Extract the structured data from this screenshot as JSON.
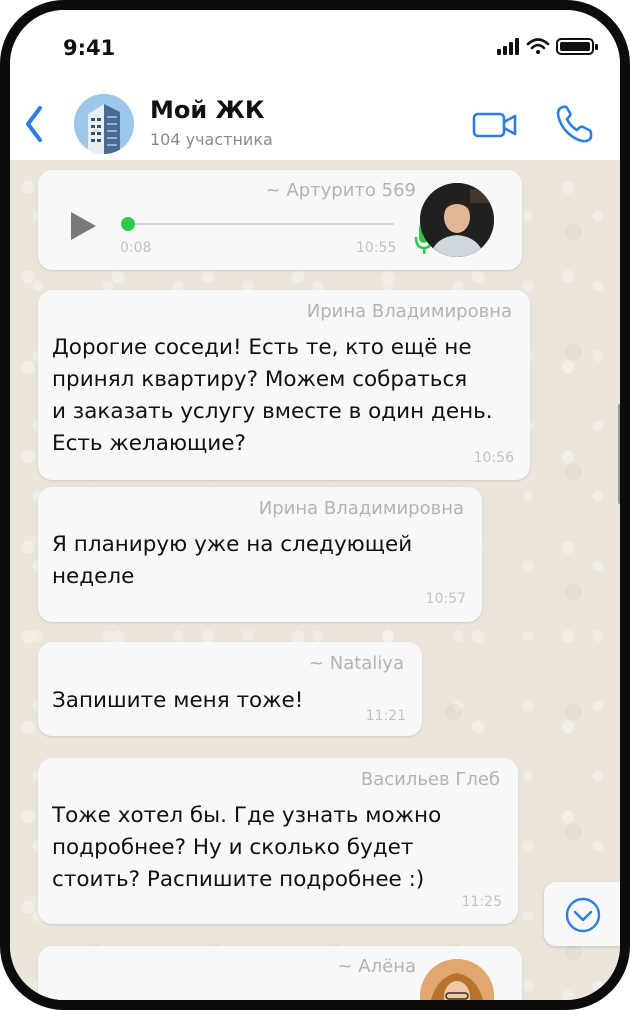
{
  "status_bar": {
    "time": "9:41"
  },
  "header": {
    "back_icon": "chevron-left-icon",
    "title": "Мой ЖК",
    "subtitle": "104 участника",
    "video_icon": "video-camera-icon",
    "call_icon": "phone-icon",
    "accent": "#2b7fe0"
  },
  "messages": [
    {
      "type": "voice",
      "sender": "~ Артурито 569",
      "elapsed": "0:08",
      "time": "10:55",
      "progress": 0.0
    },
    {
      "type": "text",
      "sender": "Ирина Владимировна",
      "lines": [
        "Дорогие соседи! Есть те, кто ещё не",
        "принял квартиру? Можем собраться",
        "и заказать услугу вместе в один день.",
        "Есть желающие?"
      ],
      "time": "10:56"
    },
    {
      "type": "text",
      "sender": "Ирина Владимировна",
      "lines": [
        "Я планирую уже на следующей",
        "неделе"
      ],
      "time": "10:57"
    },
    {
      "type": "text",
      "sender": "~ Nataliya",
      "lines": [
        "Запишите меня тоже!"
      ],
      "time": "11:21"
    },
    {
      "type": "text",
      "sender": "Васильев Глеб",
      "lines": [
        "Тоже хотел бы. Где узнать можно",
        "подробнее? Ну и сколько будет",
        "стоить? Распишите подробнее :)"
      ],
      "time": "11:25"
    },
    {
      "type": "voice",
      "sender": "~ Алёна"
    }
  ],
  "colors": {
    "chat_bg": "#ebe5dc",
    "bubble": "#f8f8f8",
    "voice_dot": "#2fc94a",
    "accent": "#2b7fe0"
  }
}
